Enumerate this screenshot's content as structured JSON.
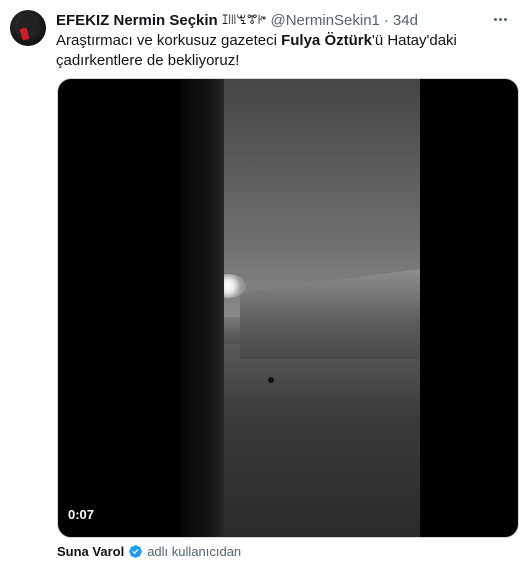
{
  "tweet": {
    "author_name": "EFEKIZ Nermin Seçkin",
    "author_symbols": "ꕯꔖꖗꔅꔶ",
    "handle": "@NerminSekin1",
    "separator": "·",
    "time": "34d",
    "text_parts": [
      "Araştırmacı ve korkusuz gazeteci ",
      "Fulya Öztürk",
      "'ü Hatay'daki çadırkentlere de bekliyoruz!"
    ]
  },
  "media": {
    "duration": "0:07"
  },
  "tagged": {
    "name": "Suna Varol",
    "suffix": "adlı kullanıcıdan"
  },
  "icons": {
    "more": "more-horizontal-icon",
    "verified": "verified-badge-icon"
  },
  "colors": {
    "text": "#0f1419",
    "secondary": "#536471",
    "verified": "#1d9bf0"
  }
}
